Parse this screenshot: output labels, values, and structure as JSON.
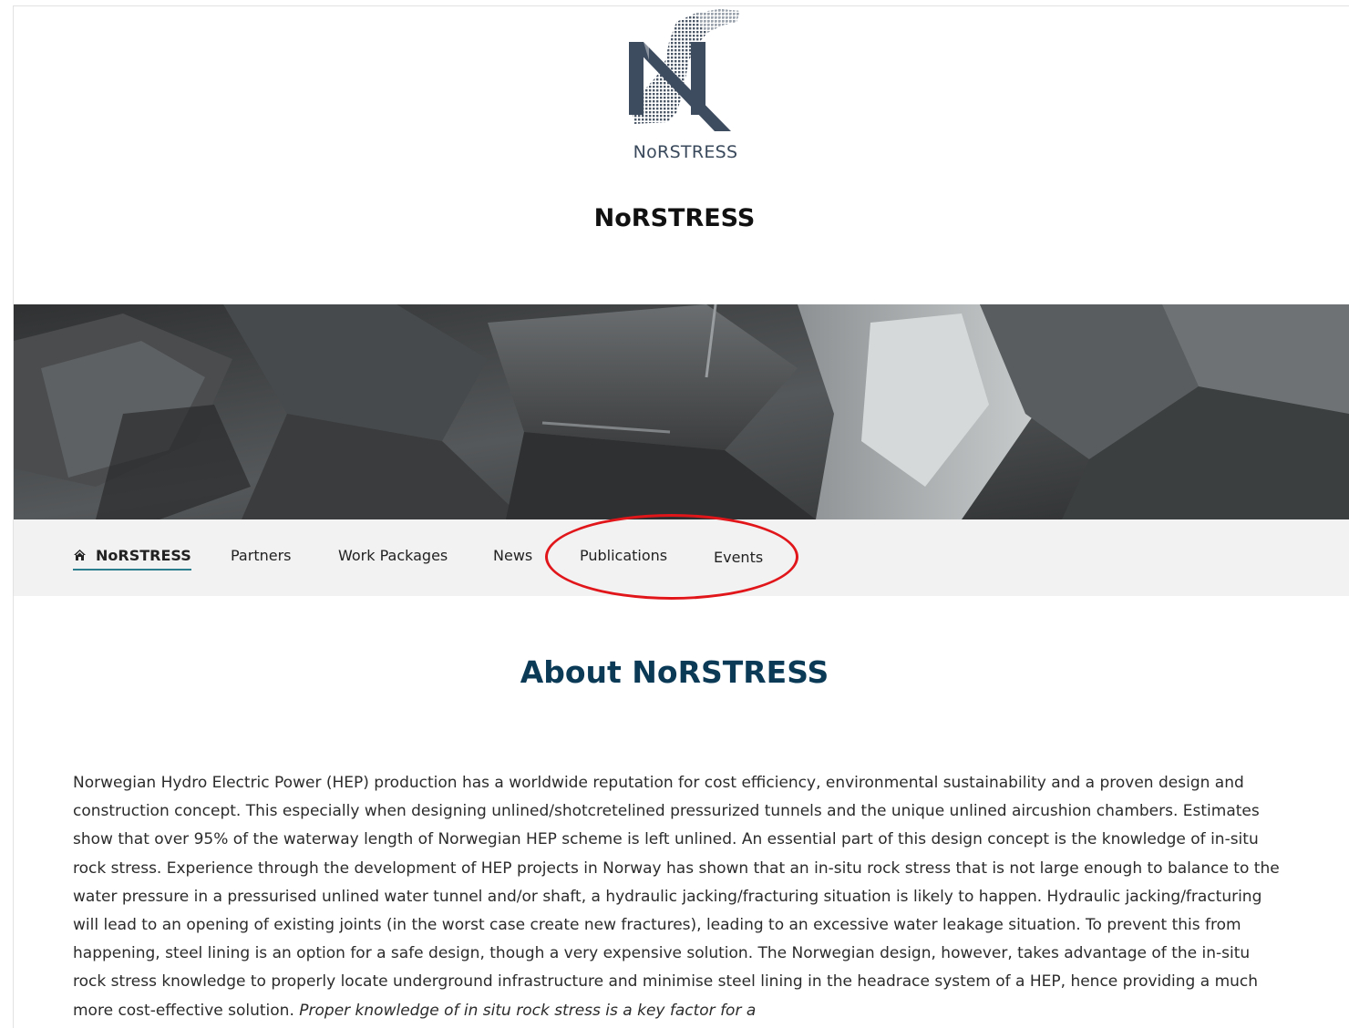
{
  "header": {
    "logo_text": "NoRSTRESS",
    "site_title": "NoRSTRESS"
  },
  "nav": {
    "items": [
      {
        "label": "NoRSTRESS",
        "icon": "home-icon",
        "active": true
      },
      {
        "label": "Partners"
      },
      {
        "label": "Work Packages"
      },
      {
        "label": "News"
      },
      {
        "label": "Publications"
      },
      {
        "label": "Events"
      }
    ]
  },
  "main": {
    "title": "About NoRSTRESS",
    "body": "Norwegian Hydro Electric Power (HEP) production has a worldwide reputation for cost efficiency, environmental sustainability and a proven design and construction concept. This especially when designing unlined/shotcretelined pressurized tunnels and the unique unlined aircushion chambers. Estimates show that over 95% of the waterway length of Norwegian HEP scheme is left unlined. An essential part of this design concept is the knowledge of in-situ rock stress. Experience through the development of HEP projects in Norway has shown that an in-situ rock stress that is not large enough to balance to the water pressure in a pressurised unlined water tunnel and/or shaft, a hydraulic jacking/fracturing situation is likely to happen. Hydraulic jacking/fracturing will lead to an opening of existing joints (in the worst case create new fractures), leading to an excessive water leakage situation. To prevent this from happening, steel lining is an option for a safe design, though a very expensive solution. The Norwegian design, however, takes advantage of the in-situ rock stress knowledge to properly locate underground infrastructure and minimise steel lining in the headrace system of a HEP, hence providing a much more cost-effective solution. ",
    "body_italic": "Proper knowledge of in situ rock stress is a key factor for a"
  },
  "colors": {
    "accent": "#2a7d8c",
    "heading": "#0b3a57",
    "annotation": "#e0161b",
    "nav_bg": "#f2f2f2"
  }
}
